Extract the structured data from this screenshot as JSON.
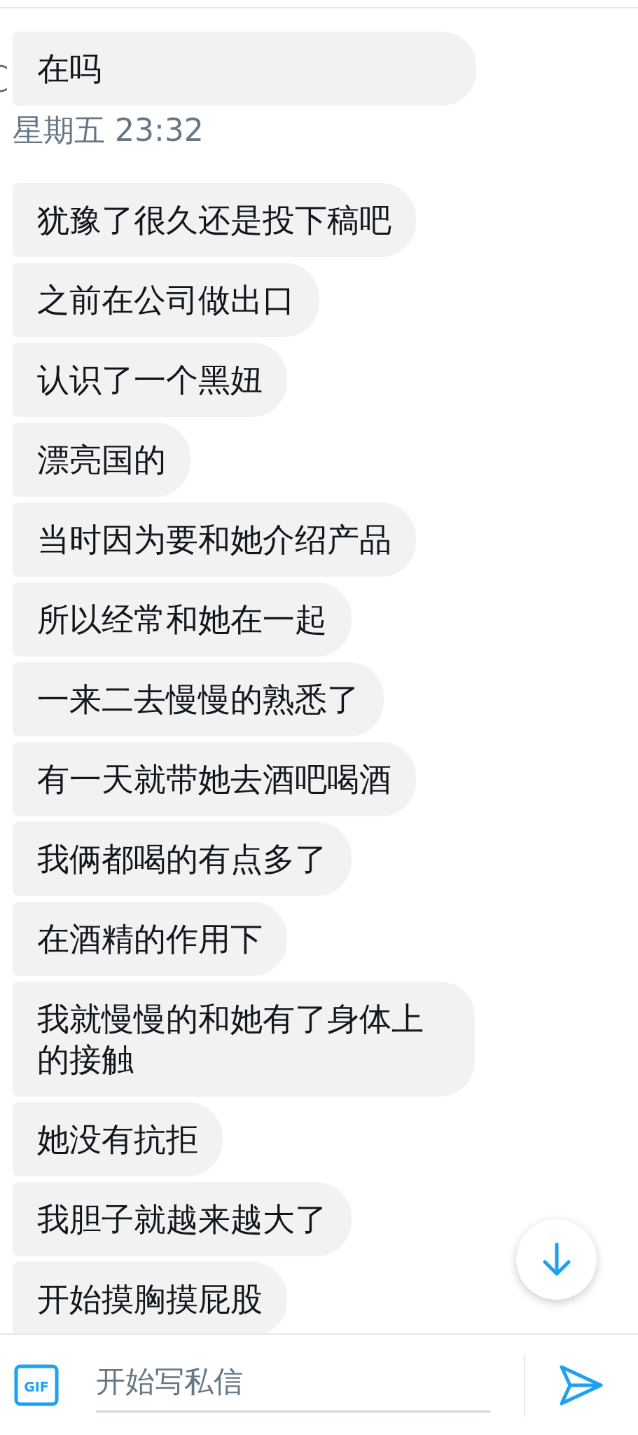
{
  "groups": [
    {
      "messages": [
        "在吗"
      ],
      "timestamp": "星期五 23:32"
    },
    {
      "messages": [
        "犹豫了很久还是投下稿吧",
        "之前在公司做出口",
        "认识了一个黑妞",
        "漂亮国的",
        "当时因为要和她介绍产品",
        "所以经常和她在一起",
        "一来二去慢慢的熟悉了",
        "有一天就带她去酒吧喝酒",
        "我俩都喝的有点多了",
        "在酒精的作用下",
        "我就慢慢的和她有了身体上的接触",
        "她没有抗拒",
        "我胆子就越来越大了",
        "开始摸胸摸屁股"
      ]
    }
  ],
  "composer": {
    "gif_label": "GIF",
    "placeholder": "开始写私信"
  }
}
